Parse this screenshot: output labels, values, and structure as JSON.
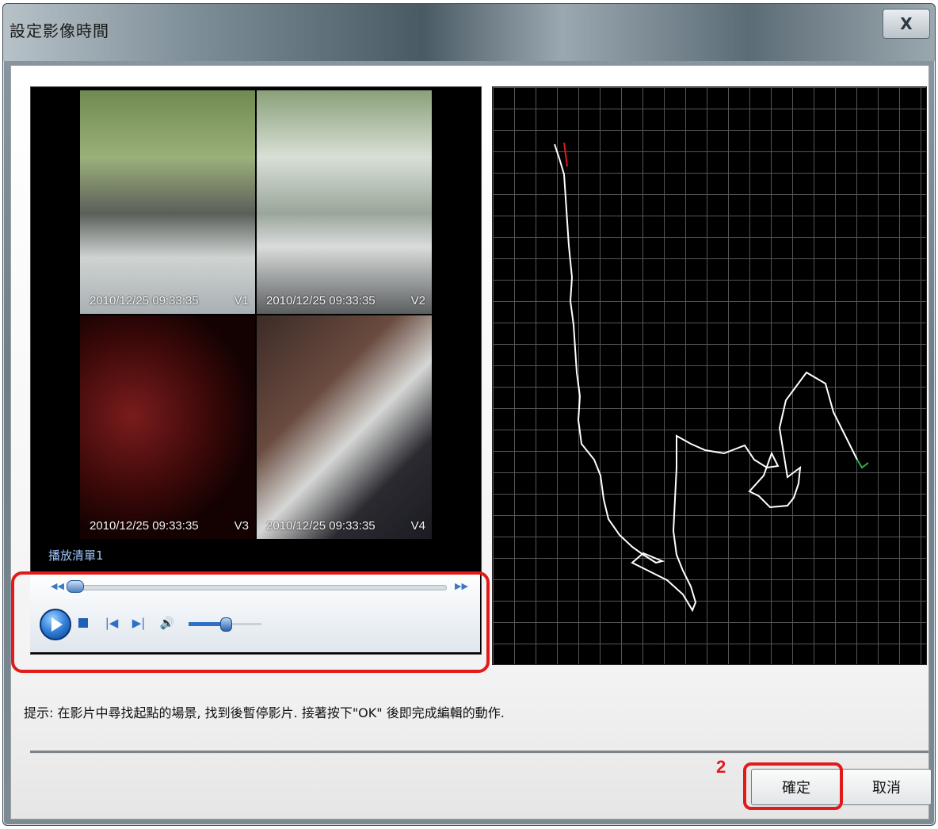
{
  "window": {
    "title": "設定影像時間",
    "close_label": "X"
  },
  "video": {
    "cameras": [
      {
        "timestamp": "2010/12/25  09:33:35",
        "label": "V1"
      },
      {
        "timestamp": "2010/12/25  09:33:35",
        "label": "V2"
      },
      {
        "timestamp": "2010/12/25  09:33:35",
        "label": "V3"
      },
      {
        "timestamp": "2010/12/25  09:33:35",
        "label": "V4"
      }
    ],
    "playlist_label": "播放清單1"
  },
  "player": {
    "seek_position": 0.02,
    "volume_level": 0.5
  },
  "hint_text": "提示: 在影片中尋找起點的場景, 找到後暫停影片. 接著按下\"OK\" 後即完成編輯的動作.",
  "buttons": {
    "ok_label": "確定",
    "cancel_label": "取消"
  },
  "annotation": {
    "step_number": "2",
    "color": "#e21a1a"
  },
  "map": {
    "background": "#000000",
    "grid_color": "#555555",
    "track_color": "#ffffff"
  }
}
